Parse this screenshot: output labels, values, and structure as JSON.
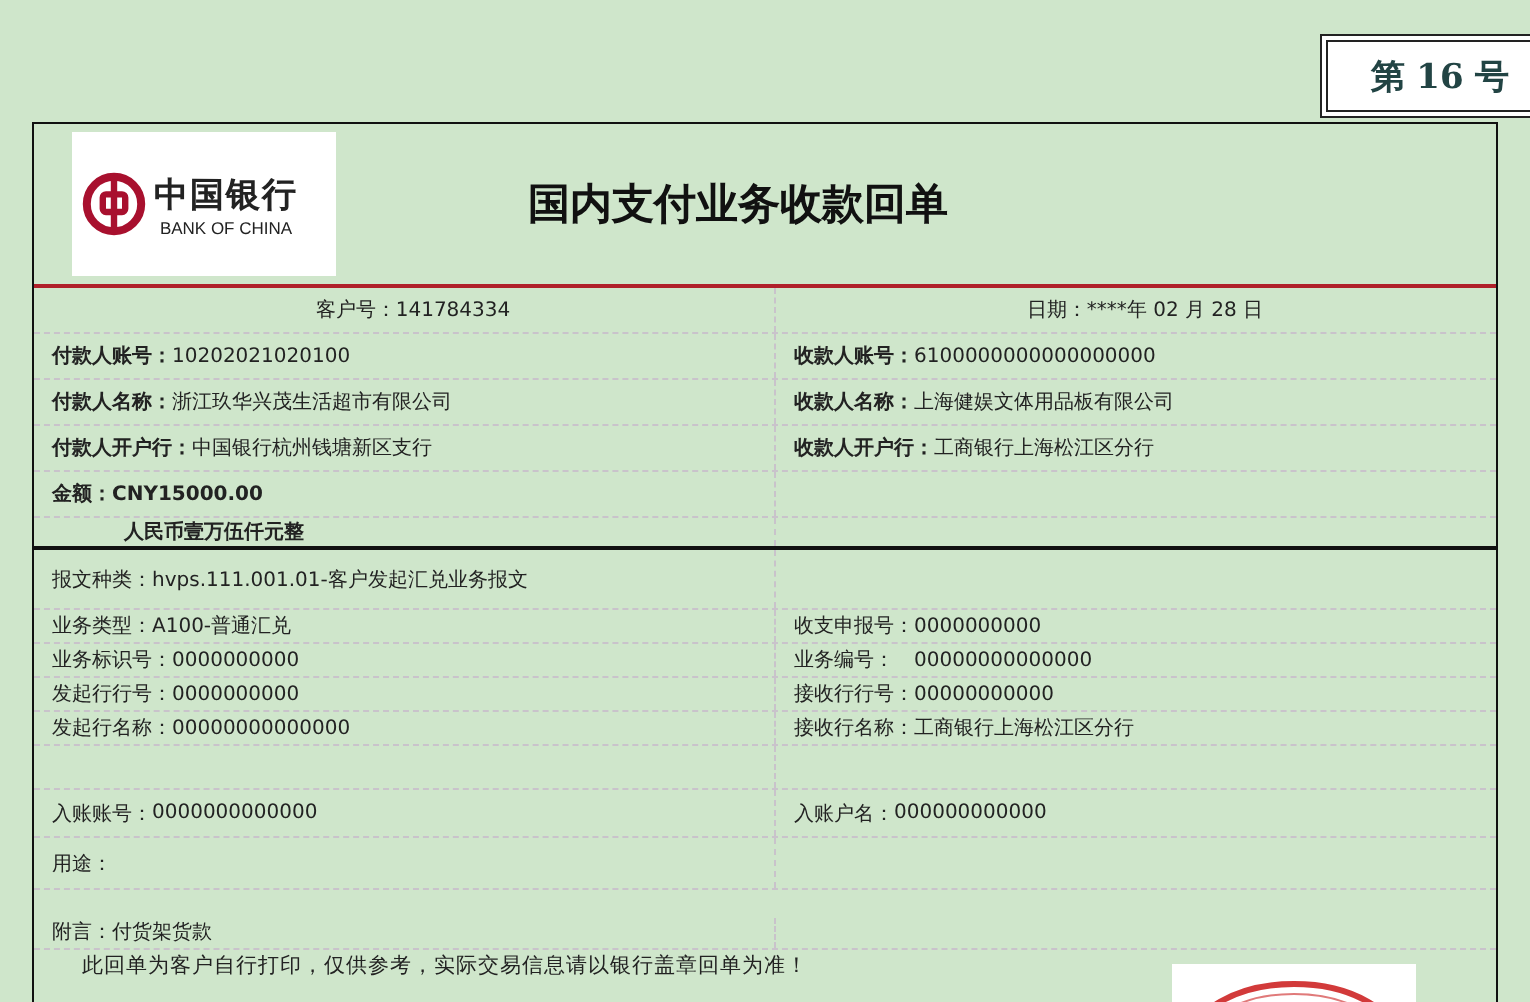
{
  "number_badge": "第 16 号",
  "logo": {
    "name_cn": "中国银行",
    "name_en": "BANK OF CHINA"
  },
  "title": "国内支付业务收款回单",
  "customer_no": {
    "label": "客户号：",
    "value": "141784334"
  },
  "date": {
    "label": "日期：",
    "value": "****年 02 月 28 日"
  },
  "parties": [
    {
      "left": {
        "label": "付款人账号：",
        "value": "10202021020100"
      },
      "right": {
        "label": "收款人账号：",
        "value": "6100000000000000000"
      }
    },
    {
      "left": {
        "label": "付款人名称：",
        "value": "浙江玖华兴茂生活超市有限公司"
      },
      "right": {
        "label": "收款人名称：",
        "value": "上海健娱文体用品板有限公司"
      }
    },
    {
      "left": {
        "label": "付款人开户行：",
        "value": "中国银行杭州钱塘新区支行"
      },
      "right": {
        "label": "收款人开户行：",
        "value": "工商银行上海松江区分行"
      }
    }
  ],
  "amount": {
    "label": "金额：",
    "value": "CNY15000.00",
    "words": "人民币壹万伍仟元整"
  },
  "message_type": {
    "label": "报文种类：",
    "value": "hvps.111.001.01-客户发起汇兑业务报文"
  },
  "details": [
    {
      "left": {
        "label": "业务类型：",
        "value": "A100-普通汇兑"
      },
      "right": {
        "label": "收支申报号：",
        "value": "0000000000"
      }
    },
    {
      "left": {
        "label": "业务标识号：",
        "value": "0000000000"
      },
      "right": {
        "label": "业务编号：",
        "value": "00000000000000"
      }
    },
    {
      "left": {
        "label": "发起行行号：",
        "value": "0000000000"
      },
      "right": {
        "label": "接收行行号：",
        "value": "00000000000"
      }
    },
    {
      "left": {
        "label": "发起行名称：",
        "value": "00000000000000"
      },
      "right": {
        "label": "接收行名称：",
        "value": "工商银行上海松江区分行"
      }
    }
  ],
  "entry": {
    "left": {
      "label": "入账账号：",
      "value": "0000000000000"
    },
    "right": {
      "label": "入账户名：",
      "value": "000000000000"
    }
  },
  "purpose": {
    "label": "用途："
  },
  "remark": {
    "label": "附言：",
    "value": "付货架货款"
  },
  "notice": "此回单为客户自行打印，仅供参考，实际交易信息请以银行盖章回单为准！"
}
